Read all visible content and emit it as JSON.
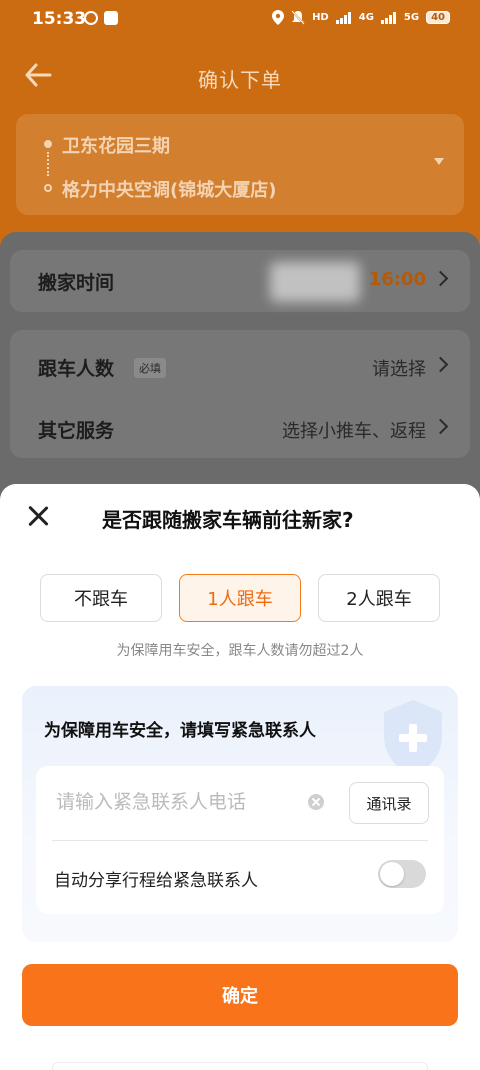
{
  "status_bar": {
    "time": "15:33",
    "battery": "40",
    "network_1": "HD",
    "network_2": "4G",
    "network_3": "5G"
  },
  "header": {
    "title": "确认下单"
  },
  "route": {
    "from": "卫东花园三期",
    "to": "格力中央空调(锦城大厦店)"
  },
  "order_rows": {
    "move_time_label": "搬家时间",
    "move_time_value": "16:00",
    "riders_label": "跟车人数",
    "riders_required_tag": "必填",
    "riders_value": "请选择",
    "other_services_label": "其它服务",
    "other_services_value": "选择小推车、返程"
  },
  "modal": {
    "title": "是否跟随搬家车辆前往新家?",
    "options": [
      "不跟车",
      "1人跟车",
      "2人跟车"
    ],
    "selected_option": "1人跟车",
    "hint": "为保障用车安全，跟车人数请勿超过2人",
    "emergency": {
      "title": "为保障用车安全，请填写紧急联系人",
      "phone_placeholder": "请输入紧急联系人电话",
      "phone_value": "",
      "contacts_button": "通讯录",
      "share_label": "自动分享行程给紧急联系人",
      "share_enabled": false
    },
    "confirm_button": "确定"
  },
  "colors": {
    "accent": "#f8731a",
    "header_bg": "#cc6c12",
    "selected_bg": "#fff4ea"
  }
}
